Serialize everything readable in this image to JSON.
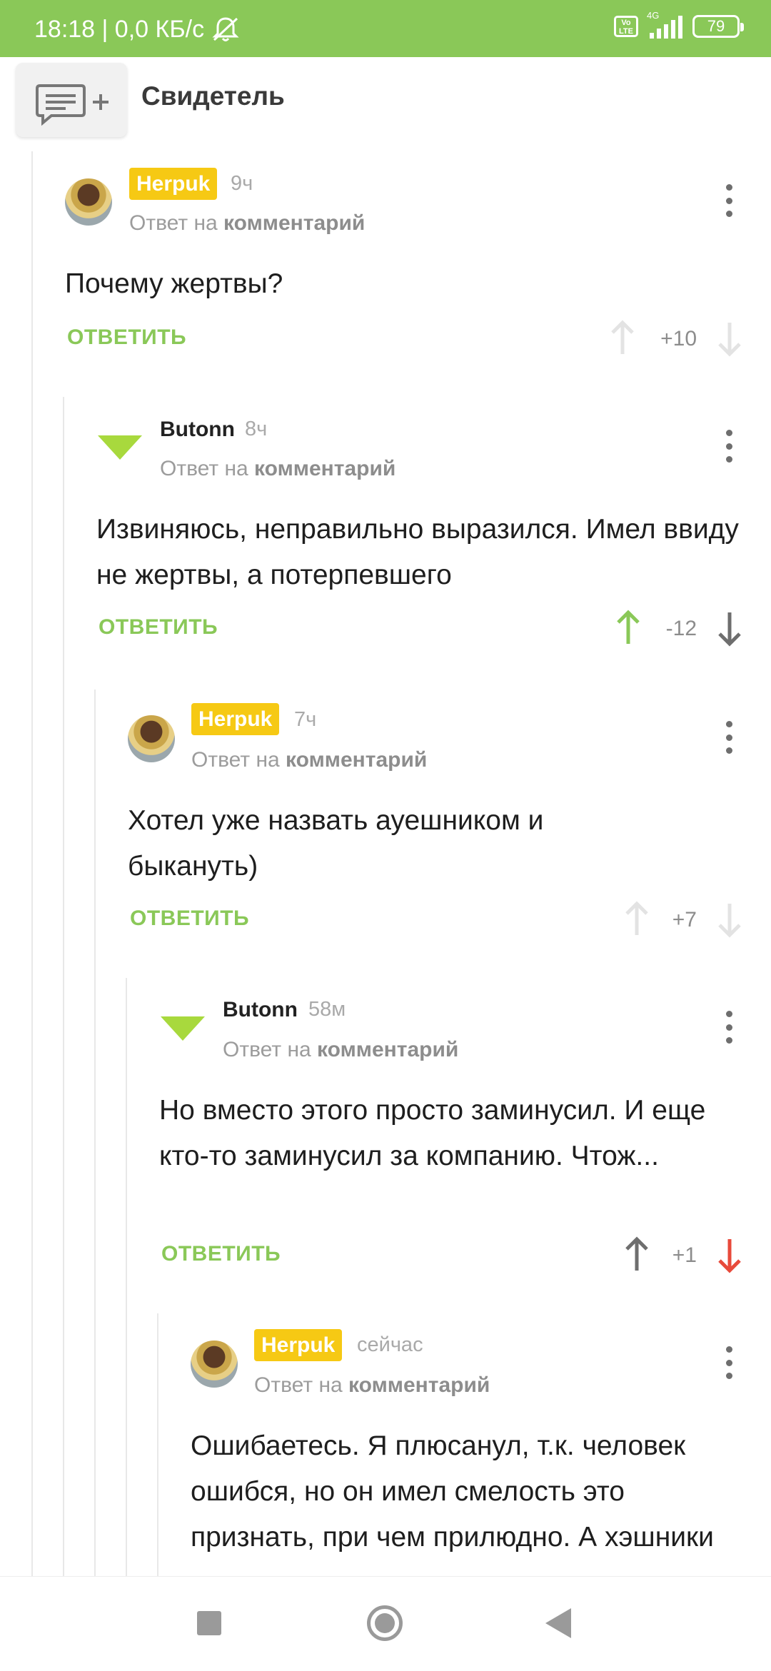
{
  "status_bar": {
    "time": "18:18 | 0,0 КБ/с",
    "volte": "Vo LTE",
    "network": "4G",
    "battery": "79"
  },
  "header": {
    "icon": "add-comment-icon",
    "title": "Свидетель"
  },
  "reply_label": "ОТВЕТИТЬ",
  "reply_to_prefix": "Ответ на",
  "reply_to_link": "комментарий",
  "colors": {
    "accent_green": "#8ac858",
    "badge_yellow": "#f6c914",
    "downvote_red": "#e84a3b"
  },
  "comments": [
    {
      "author": "Herpuk",
      "time": "9ч",
      "text": "Почему жертвы?",
      "score": "+10",
      "vote": "none"
    },
    {
      "author": "Butonn",
      "time": "8ч",
      "text": "Извиняюсь, неправильно выразился. Имел ввиду не жертвы, а потерпевшего",
      "score": "-12",
      "vote": "up"
    },
    {
      "author": "Herpuk",
      "time": "7ч",
      "text": "Хотел уже назвать ауешником и быкануть)",
      "score": "+7",
      "vote": "none"
    },
    {
      "author": "Butonn",
      "time": "58м",
      "text": "Но вместо этого просто заминусил. И еще кто-то заминусил за компанию. Чтож...",
      "score": "+1",
      "vote": "down"
    },
    {
      "author": "Herpuk",
      "time": "сейчас",
      "text": "Ошибаетесь. Я плюсанул, т.к. человек ошибся, но он имел смелость это признать, при чем прилюдно. А хэшники этого сделать не"
    }
  ]
}
